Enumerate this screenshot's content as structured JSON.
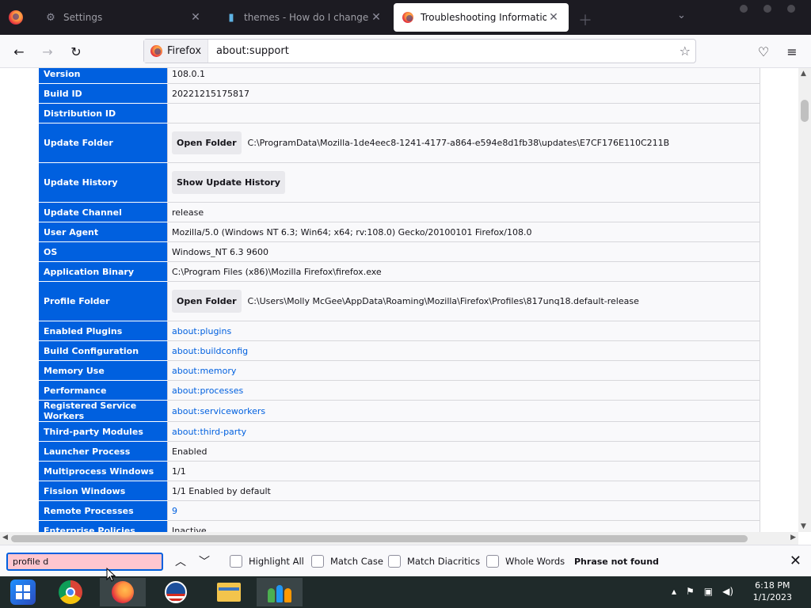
{
  "tabs": [
    {
      "title": "Settings",
      "icon": "gear-icon",
      "active": false
    },
    {
      "title": "themes - How do I change the b",
      "icon": "stackexchange-icon",
      "active": false
    },
    {
      "title": "Troubleshooting Information",
      "icon": "firefox-icon",
      "active": true
    }
  ],
  "urlbar": {
    "identity": "Firefox",
    "url": "about:support"
  },
  "rows": [
    {
      "label": "Version",
      "value": "108.0.1"
    },
    {
      "label": "Build ID",
      "value": "20221215175817"
    },
    {
      "label": "Distribution ID",
      "value": ""
    },
    {
      "label": "Update Folder",
      "button": "Open Folder",
      "value": "C:\\ProgramData\\Mozilla-1de4eec8-1241-4177-a864-e594e8d1fb38\\updates\\E7CF176E110C211B"
    },
    {
      "label": "Update History",
      "button": "Show Update History",
      "value": ""
    },
    {
      "label": "Update Channel",
      "value": "release"
    },
    {
      "label": "User Agent",
      "value": "Mozilla/5.0 (Windows NT 6.3; Win64; x64; rv:108.0) Gecko/20100101 Firefox/108.0"
    },
    {
      "label": "OS",
      "value": "Windows_NT 6.3 9600"
    },
    {
      "label": "Application Binary",
      "value": "C:\\Program Files (x86)\\Mozilla Firefox\\firefox.exe"
    },
    {
      "label": "Profile Folder",
      "button": "Open Folder",
      "value": "C:\\Users\\Molly McGee\\AppData\\Roaming\\Mozilla\\Firefox\\Profiles\\817unq18.default-release"
    },
    {
      "label": "Enabled Plugins",
      "link": "about:plugins"
    },
    {
      "label": "Build Configuration",
      "link": "about:buildconfig"
    },
    {
      "label": "Memory Use",
      "link": "about:memory"
    },
    {
      "label": "Performance",
      "link": "about:processes"
    },
    {
      "label": "Registered Service Workers",
      "link": "about:serviceworkers"
    },
    {
      "label": "Third-party Modules",
      "link": "about:third-party"
    },
    {
      "label": "Launcher Process",
      "value": "Enabled"
    },
    {
      "label": "Multiprocess Windows",
      "value": "1/1"
    },
    {
      "label": "Fission Windows",
      "value": "1/1 Enabled by default"
    },
    {
      "label": "Remote Processes",
      "link": "9"
    },
    {
      "label": "Enterprise Policies",
      "value": "Inactive"
    }
  ],
  "findbar": {
    "query": "profile d",
    "highlight_all": "Highlight All",
    "match_case": "Match Case",
    "match_diacritics": "Match Diacritics",
    "whole_words": "Whole Words",
    "status": "Phrase not found"
  },
  "clock": {
    "time": "6:18 PM",
    "date": "1/1/2023"
  }
}
